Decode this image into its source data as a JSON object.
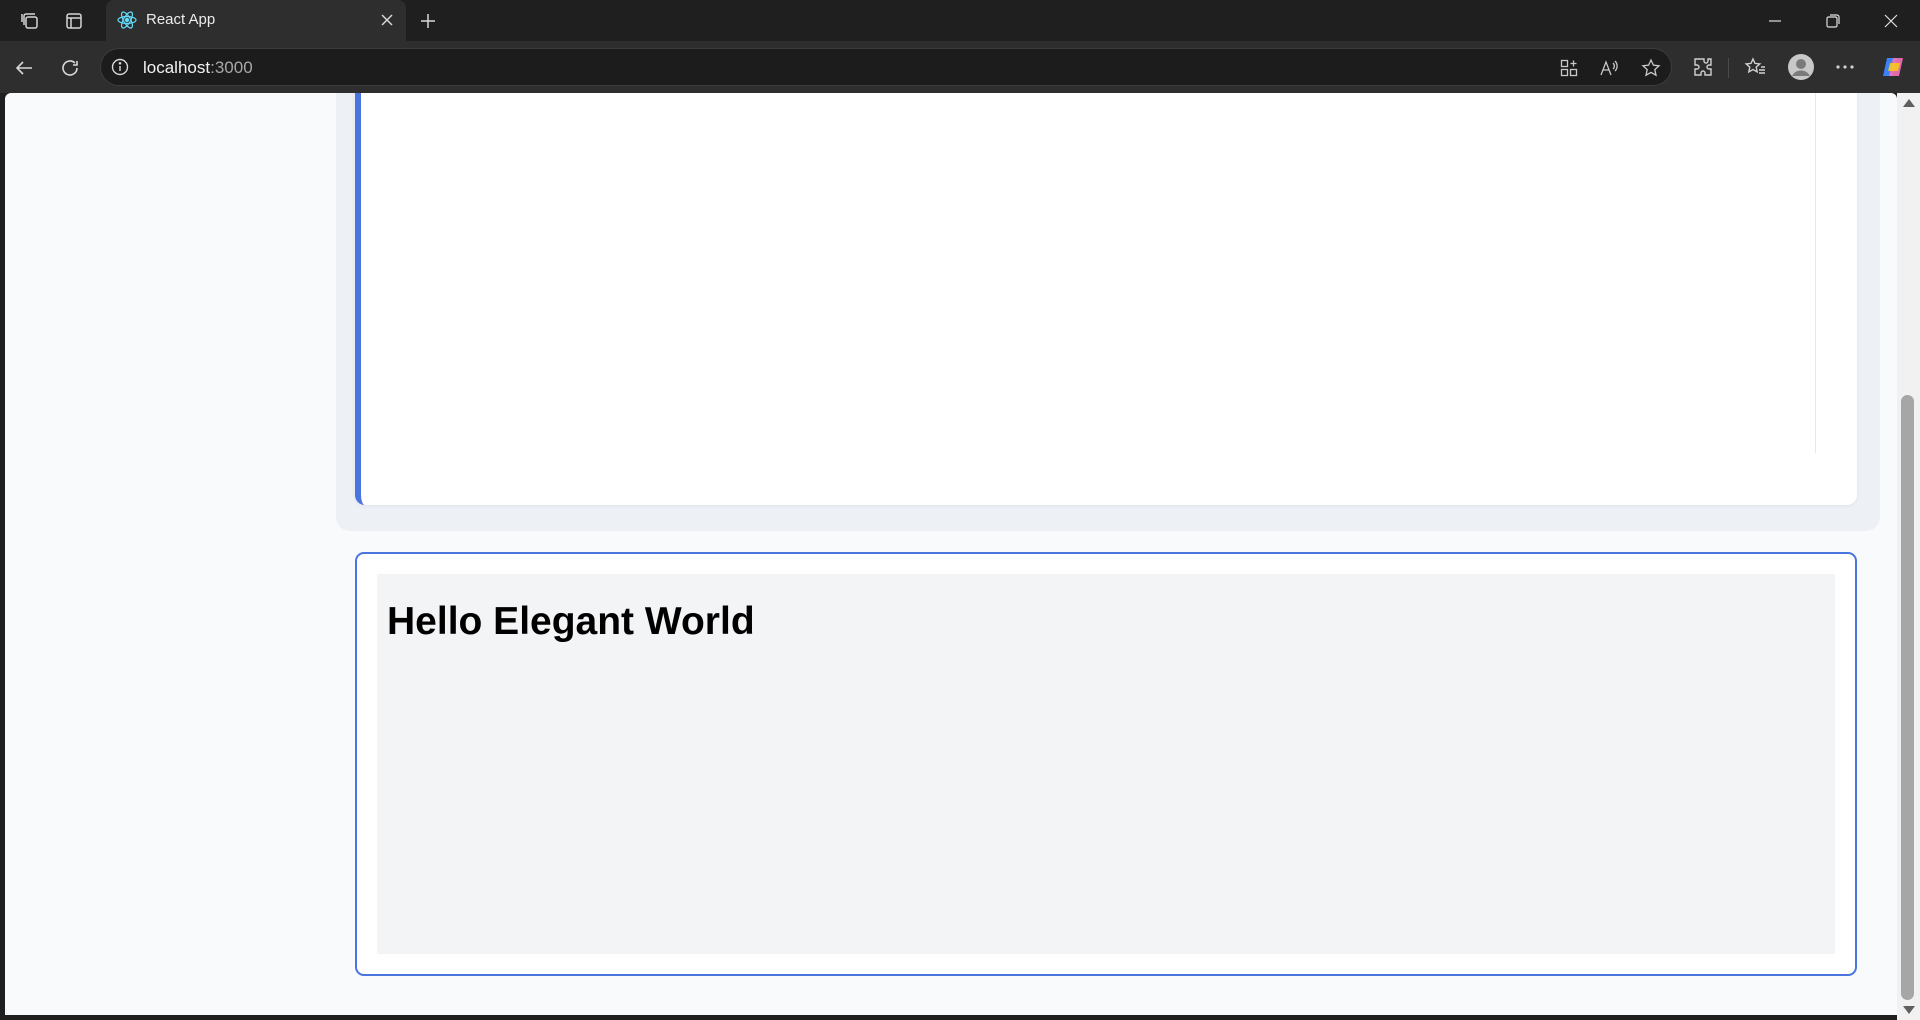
{
  "tab": {
    "title": "React App",
    "icon": "react-icon"
  },
  "address_bar": {
    "host": "localhost",
    "port": ":3000"
  },
  "page": {
    "heading": "Hello Elegant World"
  },
  "colors": {
    "accent": "#4a74de",
    "page_bg": "#f8fafc",
    "panel_bg": "#f3f4f6"
  }
}
